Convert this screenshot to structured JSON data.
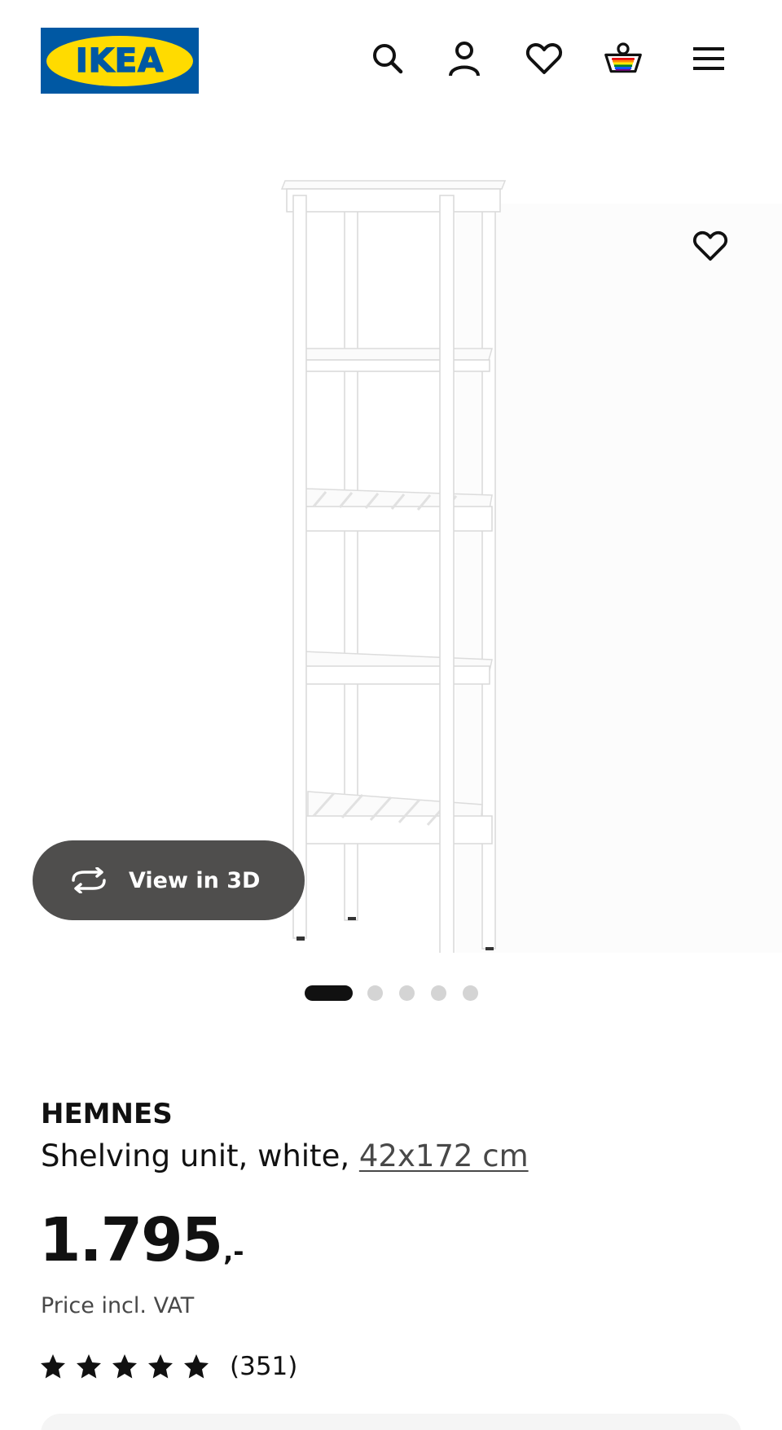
{
  "header": {
    "logo_text": "IKEA",
    "logo_reg": "®",
    "icons": [
      "search-icon",
      "account-icon",
      "heart-icon",
      "basket-icon",
      "menu-icon"
    ]
  },
  "gallery": {
    "view_3d_label": "View in 3D",
    "image_count": 5,
    "active_index": 0,
    "favorite_icon": "heart-icon"
  },
  "product": {
    "name": "HEMNES",
    "description": "Shelving unit, white, ",
    "size": "42x172 cm",
    "price_integer": "1.795",
    "price_decimal": ",-",
    "price_note": "Price incl. VAT",
    "rating": 5,
    "rating_max": 5,
    "review_count": "(351)"
  },
  "colors": {
    "brand_blue": "#0058A3",
    "brand_yellow": "#FFDB00",
    "text": "#111111",
    "muted": "#484848",
    "pill_bg": "#4F4E4D"
  }
}
